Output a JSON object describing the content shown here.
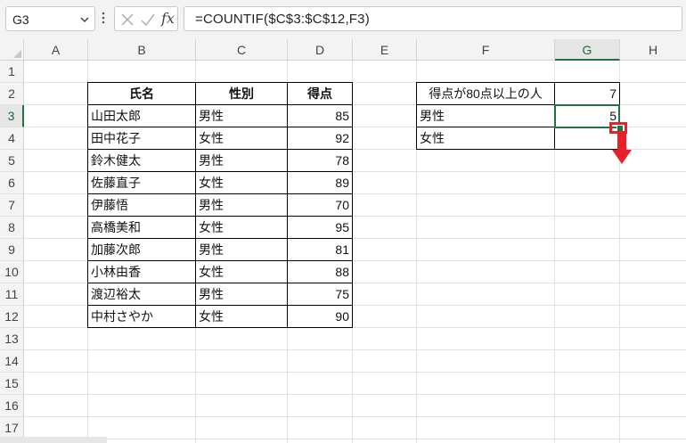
{
  "formula_bar": {
    "name_box": "G3",
    "fx_label": "fx",
    "formula": "=COUNTIF($C$3:$C$12,F3)"
  },
  "columns": [
    "A",
    "B",
    "C",
    "D",
    "E",
    "F",
    "G",
    "H"
  ],
  "rows": [
    "1",
    "2",
    "3",
    "4",
    "5",
    "6",
    "7",
    "8",
    "9",
    "10",
    "11",
    "12",
    "13",
    "14",
    "15",
    "16",
    "17"
  ],
  "table": {
    "headers": [
      "氏名",
      "性別",
      "得点"
    ],
    "rows": [
      [
        "山田太郎",
        "男性",
        "85"
      ],
      [
        "田中花子",
        "女性",
        "92"
      ],
      [
        "鈴木健太",
        "男性",
        "78"
      ],
      [
        "佐藤直子",
        "女性",
        "89"
      ],
      [
        "伊藤悟",
        "男性",
        "70"
      ],
      [
        "高橋美和",
        "女性",
        "95"
      ],
      [
        "加藤次郎",
        "男性",
        "81"
      ],
      [
        "小林由香",
        "女性",
        "88"
      ],
      [
        "渡辺裕太",
        "男性",
        "75"
      ],
      [
        "中村さやか",
        "女性",
        "90"
      ]
    ]
  },
  "summary": {
    "rows": [
      [
        "得点が80点以上の人",
        "7"
      ],
      [
        "男性",
        "5"
      ],
      [
        "女性",
        ""
      ]
    ]
  },
  "colors": {
    "selection": "#217346",
    "highlight_red": "#e8202a"
  }
}
